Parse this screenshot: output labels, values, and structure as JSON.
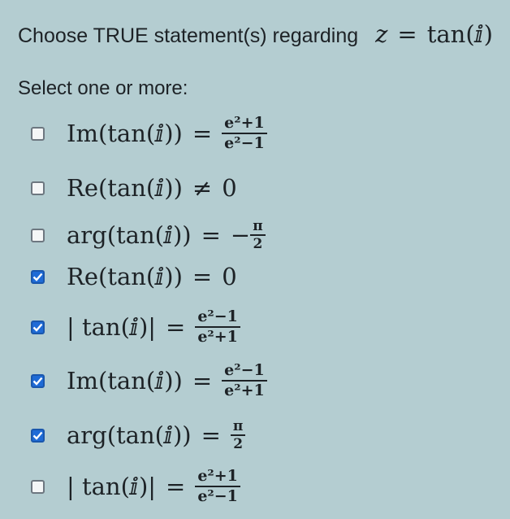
{
  "question": {
    "text": "Choose TRUE statement(s) regarding",
    "lhs": "z",
    "eq": "=",
    "rhs": "tan(ⅈ)"
  },
  "instruction": "Select one or more:",
  "options": [
    {
      "lhs": "Im(tan(ⅈ))",
      "rel": "=",
      "num": "e²+1",
      "den": "e²−1",
      "checked": false
    },
    {
      "lhs": "Re(tan(ⅈ))",
      "rel": "≠",
      "rhs": "0",
      "checked": false
    },
    {
      "lhs": "arg(tan(ⅈ))",
      "rel": "=",
      "sign": "−",
      "num": "π",
      "den": "2",
      "checked": false
    },
    {
      "lhs": "Re(tan(ⅈ))",
      "rel": "=",
      "rhs": "0",
      "checked": true
    },
    {
      "lhs": "| tan(ⅈ)|",
      "rel": "=",
      "num": "e²−1",
      "den": "e²+1",
      "checked": true
    },
    {
      "lhs": "Im(tan(ⅈ))",
      "rel": "=",
      "num": "e²−1",
      "den": "e²+1",
      "checked": true
    },
    {
      "lhs": "arg(tan(ⅈ))",
      "rel": "=",
      "num": "π",
      "den": "2",
      "checked": true
    },
    {
      "lhs": "| tan(ⅈ)|",
      "rel": "=",
      "num": "e²+1",
      "den": "e²−1",
      "checked": false
    }
  ],
  "colors": {
    "background": "#b4cdd1",
    "checkbox_checked": "#1f6bd6",
    "text": "#1d2226"
  }
}
